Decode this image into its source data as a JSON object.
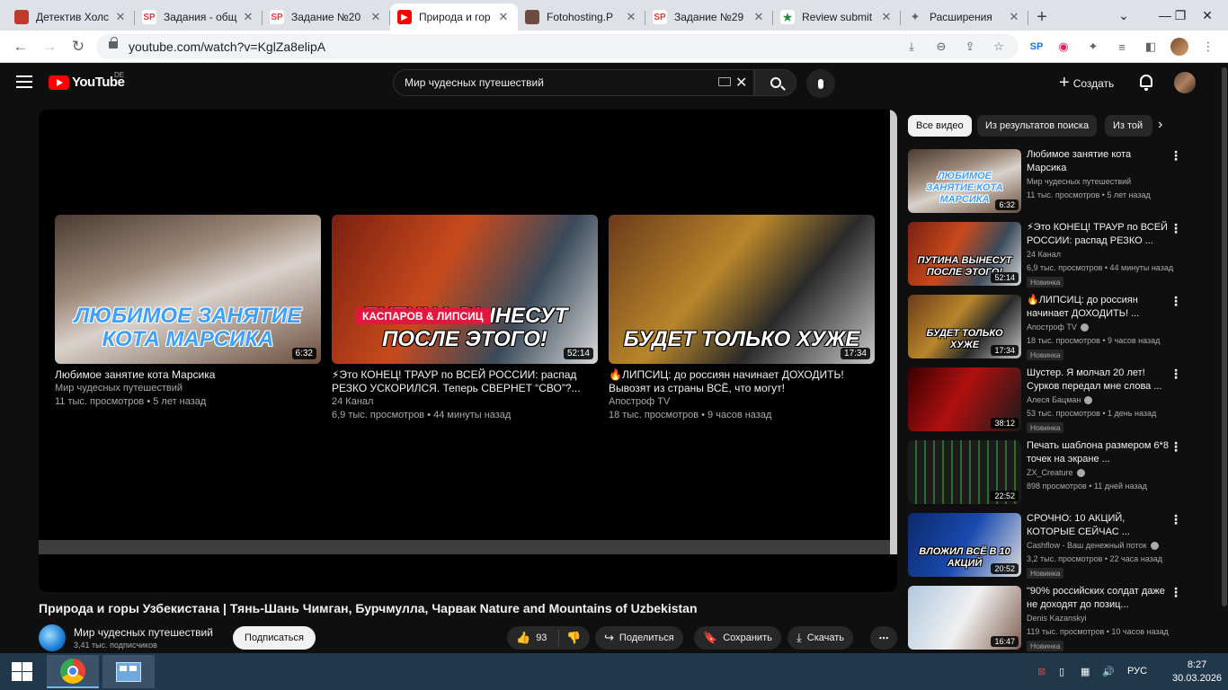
{
  "browser": {
    "tabs": [
      {
        "title": "Детектив Холс",
        "fav_color": "#c0392b",
        "fav_text": "",
        "active": false
      },
      {
        "title": "Задания - общ",
        "fav_color": "#ffffff",
        "fav_text": "SP",
        "active": false
      },
      {
        "title": "Задание №20",
        "fav_color": "#ffffff",
        "fav_text": "SP",
        "active": false
      },
      {
        "title": "Природа и гор",
        "fav_color": "#ff0000",
        "fav_text": "▶",
        "active": true
      },
      {
        "title": "Fotohosting.P",
        "fav_color": "#6d4c41",
        "fav_text": "",
        "active": false
      },
      {
        "title": "Задание №29",
        "fav_color": "#ffffff",
        "fav_text": "SP",
        "active": false
      },
      {
        "title": "Review submit",
        "fav_color": "#ffffff",
        "fav_text": "★",
        "active": false
      },
      {
        "title": "Расширения",
        "fav_color": "#dee1e6",
        "fav_text": "✦",
        "active": false
      }
    ],
    "url": "youtube.com/watch?v=KglZa8elipA"
  },
  "youtube": {
    "logo_text": "YouTube",
    "country": "DE",
    "search_value": "Мир чудесных путешествий",
    "create_label": "Создать",
    "player_cards": [
      {
        "title": "Любимое занятие кота Марсика",
        "channel": "Мир чудесных путешествий",
        "meta": "11 тыс. просмотров • 5 лет назад",
        "duration": "6:32",
        "thumb_text": "Любимое занятие кота Марсика"
      },
      {
        "title": "⚡Это КОНЕЦ! ТРАУР по ВСЕЙ РОССИИ: распад РЕЗКО УСКОРИЛСЯ. Теперь СВЕРНЕТ “СВО”?...",
        "channel": "24 Канал",
        "meta": "6,9 тыс. просмотров • 44 минуты назад",
        "duration": "52:14",
        "thumb_badge": "КАСПАРОВ & ЛИПСИЦ",
        "thumb_text": "ПУТИНА ВЫНЕСУТ ПОСЛЕ ЭТОГО!"
      },
      {
        "title": "🔥ЛИПСИЦ: до россиян начинает ДОХОДИТЬ! Вывозят из страны ВСЁ, что могут!",
        "channel": "Апостроф TV",
        "meta": "18 тыс. просмотров • 9 часов назад",
        "duration": "17:34",
        "thumb_text": "БУДЕТ ТОЛЬКО ХУЖЕ"
      }
    ],
    "video_title": "Природа и горы Узбекистана | Тянь-Шань Чимган, Бурчмулла, Чарвак Nature and Mountains of Uzbekistan",
    "channel_name": "Мир чудесных путешествий",
    "channel_subs": "3,41 тыс. подписчиков",
    "subscribe_label": "Подписаться",
    "like_count": "93",
    "share_label": "Поделиться",
    "save_label": "Сохранить",
    "download_label": "Скачать",
    "chips": [
      "Все видео",
      "Из результатов поиска",
      "Из той"
    ],
    "sidebar": [
      {
        "title": "Любимое занятие кота Марсика",
        "channel": "Мир чудесных путешествий",
        "meta": "11 тыс. просмотров • 5 лет назад",
        "duration": "6:32",
        "badge": "",
        "thumb_text": "Любимое занятие кота Марсика"
      },
      {
        "title": "⚡Это КОНЕЦ! ТРАУР по ВСЕЙ РОССИИ: распад РЕЗКО ...",
        "channel": "24 Канал",
        "meta": "6,9 тыс. просмотров • 44 минуты назад",
        "duration": "52:14",
        "badge": "Новинка",
        "thumb_text": "ПУТИНА ВЫНЕСУТ ПОСЛЕ ЭТОГО!"
      },
      {
        "title": "🔥ЛИПСИЦ: до россиян начинает ДОХОДИТЬ! ...",
        "channel": "Апостроф TV",
        "meta": "18 тыс. просмотров • 9 часов назад",
        "duration": "17:34",
        "badge": "Новинка",
        "thumb_text": "БУДЕТ ТОЛЬКО ХУЖЕ"
      },
      {
        "title": "Шустер. Я молчал 20 лет! Сурков передал мне слова ...",
        "channel": "Алеся Бацман",
        "meta": "53 тыс. просмотров • 1 день назад",
        "duration": "38:12",
        "badge": "Новинка",
        "thumb_text": ""
      },
      {
        "title": "Печать шаблона размером 6*8 точек на экране ...",
        "channel": "ZX_Creature",
        "meta": "898 просмотров • 11 дней назад",
        "duration": "22:52",
        "badge": "",
        "thumb_text": ""
      },
      {
        "title": "СРОЧНО: 10 АКЦИЙ, КОТОРЫЕ СЕЙЧАС ...",
        "channel": "Cashflow - Ваш денежный поток",
        "meta": "3,2 тыс. просмотров • 22 часа назад",
        "duration": "20:52",
        "badge": "Новинка",
        "thumb_text": "ВЛОЖИЛ ВСЁ В 10 АКЦИЙ"
      },
      {
        "title": "\"90% российских солдат даже не доходят до позиц...",
        "channel": "Denis Kazanskyi",
        "meta": "119 тыс. просмотров • 10 часов назад",
        "duration": "16:47",
        "badge": "Новинка",
        "thumb_text": ""
      }
    ]
  },
  "taskbar": {
    "lang": "РУС",
    "time": "8:27",
    "date": "30.03.2026"
  }
}
